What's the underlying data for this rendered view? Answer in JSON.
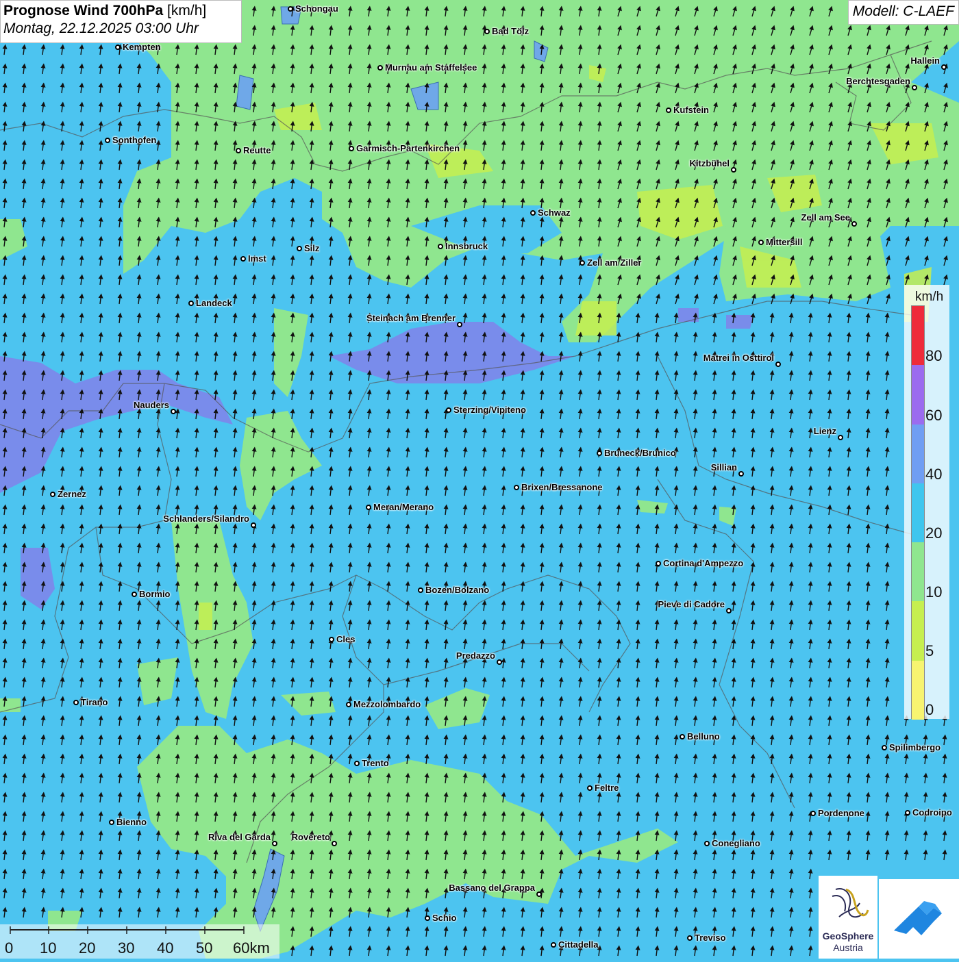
{
  "title": {
    "main": "Prognose Wind 700hPa",
    "unit": "[km/h]",
    "subtitle": "Montag, 22.12.2025 03:00 Uhr"
  },
  "model": "Modell: C-LAEF",
  "legend": {
    "unit": "km/h",
    "labels": [
      "80",
      "60",
      "40",
      "20",
      "10",
      "5",
      "0"
    ],
    "colors": [
      "#ee2b3a",
      "#9b6bef",
      "#6f9ef3",
      "#3fc6ee",
      "#8fe68f",
      "#c6ef50",
      "#f7f470"
    ],
    "levels": [
      0,
      5,
      10,
      20,
      40,
      60,
      80
    ]
  },
  "wind": {
    "direction": "SSW",
    "flow": "northward"
  },
  "cities": [
    "Schongau",
    "Kempten",
    "Bad Tölz",
    "Murnau am Staffelsee",
    "Hallein",
    "Berchtesgaden",
    "Kufstein",
    "Sonthofen",
    "Reutte",
    "Garmisch-Partenkirchen",
    "Kitzbühel",
    "Schwaz",
    "Zell am See",
    "Innsbruck",
    "Mittersill",
    "Imst",
    "Silz",
    "Zell am Ziller",
    "Landeck",
    "Steinach am Brenner",
    "Matrei in Osttirol",
    "Nauders",
    "Sterzing/Vipiteno",
    "Lienz",
    "Bruneck/Brunico",
    "Sillian",
    "Zernez",
    "Brixen/Bressanone",
    "Meran/Merano",
    "Schlanders/Silandro",
    "Cortina d'Ampezzo",
    "Bozen/Bolzano",
    "Bormio",
    "Pieve di Cadore",
    "Cles",
    "Predazzo",
    "Tirano",
    "Mezzolombardo",
    "Belluno",
    "Spilimbergo",
    "Trento",
    "Feltre",
    "Pordenone",
    "Codroipo",
    "Bienno",
    "Riva del Garda",
    "Rovereto",
    "Conegliano",
    "Bassano del Grappa",
    "Schio",
    "Treviso",
    "Cittadella"
  ],
  "scale": {
    "labels": [
      "0",
      "10",
      "20",
      "30",
      "40",
      "50",
      "60km"
    ]
  },
  "logos": {
    "geosphere_line1": "GeoSphere",
    "geosphere_line2": "Austria"
  }
}
